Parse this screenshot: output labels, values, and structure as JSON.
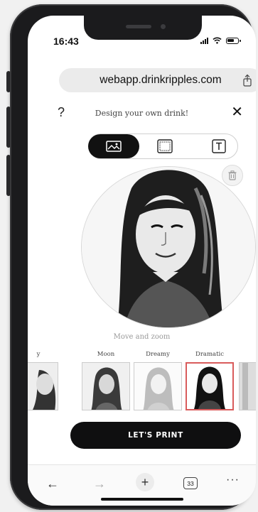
{
  "status": {
    "time": "16:43"
  },
  "browser": {
    "url": "webapp.drinkripples.com",
    "tab_count": "33"
  },
  "editor": {
    "help_label": "?",
    "title": "Design your own drink!",
    "hint": "Move and zoom",
    "print_button": "LET'S PRINT",
    "filters": [
      {
        "label": "y"
      },
      {
        "label": "Moon"
      },
      {
        "label": "Dreamy"
      },
      {
        "label": "Dramatic",
        "selected": true
      }
    ]
  },
  "colors": {
    "accent_selected": "#d95b5b",
    "primary_button": "#0f0f10"
  },
  "icons": [
    "share-icon",
    "help-icon",
    "close-icon",
    "image-icon",
    "frame-icon",
    "text-icon",
    "trash-icon",
    "back-icon",
    "forward-icon",
    "new-tab-icon",
    "tabs-icon",
    "more-icon"
  ]
}
